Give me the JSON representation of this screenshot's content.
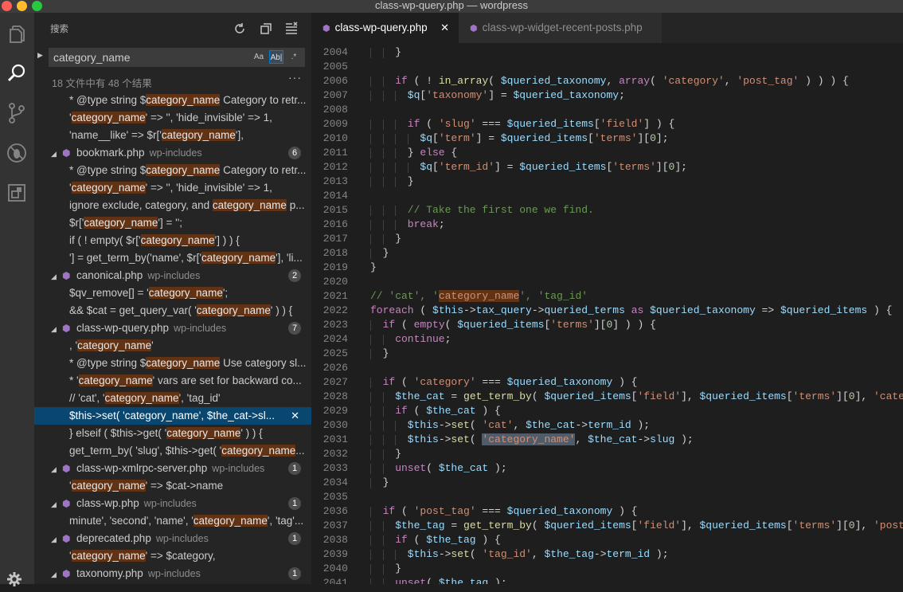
{
  "window": {
    "title": "class-wp-query.php — wordpress"
  },
  "activity_bar": [
    {
      "name": "explorer-icon",
      "active": false
    },
    {
      "name": "search-icon",
      "active": true
    },
    {
      "name": "source-control-icon",
      "active": false
    },
    {
      "name": "debug-icon",
      "active": false
    },
    {
      "name": "extensions-icon",
      "active": false
    }
  ],
  "sidebar": {
    "title": "搜索",
    "search_value": "category_name",
    "opt_case": "Aa",
    "opt_word": "Ab|",
    "opt_regex": ".*",
    "summary": "18 文件中有 48 个结果",
    "more": "···"
  },
  "results": [
    {
      "type": "match",
      "parts": [
        [
          "* @type string $",
          0
        ],
        [
          "category_name",
          1
        ],
        [
          " Category to retr...",
          0
        ]
      ]
    },
    {
      "type": "match",
      "parts": [
        [
          "'",
          0
        ],
        [
          "category_name",
          1
        ],
        [
          "' => '', 'hide_invisible' => 1,",
          0
        ]
      ]
    },
    {
      "type": "match",
      "parts": [
        [
          "'name__like' => $r['",
          0
        ],
        [
          "category_name",
          1
        ],
        [
          "'],",
          0
        ]
      ]
    },
    {
      "type": "file",
      "name": "bookmark.php",
      "dir": "wp-includes",
      "count": "6"
    },
    {
      "type": "match",
      "parts": [
        [
          "* @type string $",
          0
        ],
        [
          "category_name",
          1
        ],
        [
          " Category to retr...",
          0
        ]
      ]
    },
    {
      "type": "match",
      "parts": [
        [
          "'",
          0
        ],
        [
          "category_name",
          1
        ],
        [
          "' => '', 'hide_invisible' => 1,",
          0
        ]
      ]
    },
    {
      "type": "match",
      "parts": [
        [
          "ignore exclude, category, and ",
          0
        ],
        [
          "category_name",
          1
        ],
        [
          " p...",
          0
        ]
      ]
    },
    {
      "type": "match",
      "parts": [
        [
          "$r['",
          0
        ],
        [
          "category_name",
          1
        ],
        [
          "'] = '';",
          0
        ]
      ]
    },
    {
      "type": "match",
      "parts": [
        [
          "if ( ! empty( $r['",
          0
        ],
        [
          "category_name",
          1
        ],
        [
          "'] ) ) {",
          0
        ]
      ]
    },
    {
      "type": "match",
      "parts": [
        [
          "'] = get_term_by('name', $r['",
          0
        ],
        [
          "category_name",
          1
        ],
        [
          "'], 'li...",
          0
        ]
      ]
    },
    {
      "type": "file",
      "name": "canonical.php",
      "dir": "wp-includes",
      "count": "2"
    },
    {
      "type": "match",
      "parts": [
        [
          "$qv_remove[] = '",
          0
        ],
        [
          "category_name",
          1
        ],
        [
          "';",
          0
        ]
      ]
    },
    {
      "type": "match",
      "parts": [
        [
          "&& $cat = get_query_var( '",
          0
        ],
        [
          "category_name",
          1
        ],
        [
          "' ) ) {",
          0
        ]
      ]
    },
    {
      "type": "file",
      "name": "class-wp-query.php",
      "dir": "wp-includes",
      "count": "7"
    },
    {
      "type": "match",
      "parts": [
        [
          ", '",
          0
        ],
        [
          "category_name",
          1
        ],
        [
          "'",
          0
        ]
      ]
    },
    {
      "type": "match",
      "parts": [
        [
          "* @type string $",
          0
        ],
        [
          "category_name",
          1
        ],
        [
          " Use category sl...",
          0
        ]
      ]
    },
    {
      "type": "match",
      "parts": [
        [
          "* '",
          0
        ],
        [
          "category_name",
          1
        ],
        [
          "' vars are set for backward co...",
          0
        ]
      ]
    },
    {
      "type": "match",
      "parts": [
        [
          "// 'cat', '",
          0
        ],
        [
          "category_name",
          1
        ],
        [
          "', 'tag_id'",
          0
        ]
      ]
    },
    {
      "type": "match",
      "selected": true,
      "parts": [
        [
          "$this->set( '",
          0
        ],
        [
          "category_name",
          1
        ],
        [
          "', $the_cat->sl...",
          0
        ]
      ]
    },
    {
      "type": "match",
      "parts": [
        [
          "} elseif ( $this->get( '",
          0
        ],
        [
          "category_name",
          1
        ],
        [
          "' ) ) {",
          0
        ]
      ]
    },
    {
      "type": "match",
      "parts": [
        [
          "get_term_by( 'slug', $this->get( '",
          0
        ],
        [
          "category_name",
          1
        ],
        [
          "...",
          0
        ]
      ]
    },
    {
      "type": "file",
      "name": "class-wp-xmlrpc-server.php",
      "dir": "wp-includes",
      "count": "1"
    },
    {
      "type": "match",
      "parts": [
        [
          "'",
          0
        ],
        [
          "category_name",
          1
        ],
        [
          "' => $cat->name",
          0
        ]
      ]
    },
    {
      "type": "file",
      "name": "class-wp.php",
      "dir": "wp-includes",
      "count": "1"
    },
    {
      "type": "match",
      "parts": [
        [
          "minute', 'second', 'name', '",
          0
        ],
        [
          "category_name",
          1
        ],
        [
          "', 'tag'...",
          0
        ]
      ]
    },
    {
      "type": "file",
      "name": "deprecated.php",
      "dir": "wp-includes",
      "count": "1"
    },
    {
      "type": "match",
      "parts": [
        [
          "'",
          0
        ],
        [
          "category_name",
          1
        ],
        [
          "' => $category,",
          0
        ]
      ]
    },
    {
      "type": "file",
      "name": "taxonomy.php",
      "dir": "wp-includes",
      "count": "1"
    }
  ],
  "tabs": [
    {
      "label": "class-wp-query.php",
      "active": true
    },
    {
      "label": "class-wp-widget-recent-posts.php",
      "active": false
    }
  ],
  "code_lines": [
    {
      "n": "2004",
      "indent": 2,
      "toks": [
        [
          "}",
          "p"
        ]
      ]
    },
    {
      "n": "2005",
      "indent": 0,
      "toks": []
    },
    {
      "n": "2006",
      "indent": 2,
      "toks": [
        [
          "if",
          "k"
        ],
        [
          " ( ! ",
          "p"
        ],
        [
          "in_array",
          "f"
        ],
        [
          "( ",
          "p"
        ],
        [
          "$queried_taxonomy",
          "v"
        ],
        [
          ", ",
          "p"
        ],
        [
          "array",
          "k"
        ],
        [
          "( ",
          "p"
        ],
        [
          "'category'",
          "s"
        ],
        [
          ", ",
          "p"
        ],
        [
          "'post_tag'",
          "s"
        ],
        [
          " ) ) ) {",
          "p"
        ]
      ]
    },
    {
      "n": "2007",
      "indent": 3,
      "toks": [
        [
          "$q",
          "v"
        ],
        [
          "[",
          "p"
        ],
        [
          "'taxonomy'",
          "s"
        ],
        [
          "] = ",
          "p"
        ],
        [
          "$queried_taxonomy",
          "v"
        ],
        [
          ";",
          "p"
        ]
      ]
    },
    {
      "n": "2008",
      "indent": 0,
      "toks": []
    },
    {
      "n": "2009",
      "indent": 3,
      "toks": [
        [
          "if",
          "k"
        ],
        [
          " ( ",
          "p"
        ],
        [
          "'slug'",
          "s"
        ],
        [
          " === ",
          "p"
        ],
        [
          "$queried_items",
          "v"
        ],
        [
          "[",
          "p"
        ],
        [
          "'field'",
          "s"
        ],
        [
          "] ) {",
          "p"
        ]
      ]
    },
    {
      "n": "2010",
      "indent": 4,
      "toks": [
        [
          "$q",
          "v"
        ],
        [
          "[",
          "p"
        ],
        [
          "'term'",
          "s"
        ],
        [
          "] = ",
          "p"
        ],
        [
          "$queried_items",
          "v"
        ],
        [
          "[",
          "p"
        ],
        [
          "'terms'",
          "s"
        ],
        [
          "][",
          "p"
        ],
        [
          "0",
          "n"
        ],
        [
          "];",
          "p"
        ]
      ]
    },
    {
      "n": "2011",
      "indent": 3,
      "toks": [
        [
          "} ",
          "p"
        ],
        [
          "else",
          "k"
        ],
        [
          " {",
          "p"
        ]
      ]
    },
    {
      "n": "2012",
      "indent": 4,
      "toks": [
        [
          "$q",
          "v"
        ],
        [
          "[",
          "p"
        ],
        [
          "'term_id'",
          "s"
        ],
        [
          "] = ",
          "p"
        ],
        [
          "$queried_items",
          "v"
        ],
        [
          "[",
          "p"
        ],
        [
          "'terms'",
          "s"
        ],
        [
          "][",
          "p"
        ],
        [
          "0",
          "n"
        ],
        [
          "];",
          "p"
        ]
      ]
    },
    {
      "n": "2013",
      "indent": 3,
      "toks": [
        [
          "}",
          "p"
        ]
      ]
    },
    {
      "n": "2014",
      "indent": 0,
      "toks": []
    },
    {
      "n": "2015",
      "indent": 3,
      "toks": [
        [
          "// Take the first one we find.",
          "c"
        ]
      ]
    },
    {
      "n": "2016",
      "indent": 3,
      "toks": [
        [
          "break",
          "k"
        ],
        [
          ";",
          "p"
        ]
      ]
    },
    {
      "n": "2017",
      "indent": 2,
      "toks": [
        [
          "}",
          "p"
        ]
      ]
    },
    {
      "n": "2018",
      "indent": 1,
      "toks": [
        [
          "}",
          "p"
        ]
      ]
    },
    {
      "n": "2019",
      "indent": 0,
      "toks": [
        [
          "}",
          "p"
        ]
      ]
    },
    {
      "n": "2020",
      "indent": 0,
      "toks": []
    },
    {
      "n": "2021",
      "indent": 0,
      "toks": [
        [
          "// 'cat', '",
          "c"
        ],
        [
          "category_name",
          "h"
        ],
        [
          "', 'tag_id'",
          "c"
        ]
      ]
    },
    {
      "n": "2022",
      "indent": 0,
      "toks": [
        [
          "foreach",
          "k"
        ],
        [
          " ( ",
          "p"
        ],
        [
          "$this",
          "v"
        ],
        [
          "->",
          "p"
        ],
        [
          "tax_query",
          "v"
        ],
        [
          "->",
          "p"
        ],
        [
          "queried_terms",
          "v"
        ],
        [
          " ",
          "p"
        ],
        [
          "as",
          "k"
        ],
        [
          " ",
          "p"
        ],
        [
          "$queried_taxonomy",
          "v"
        ],
        [
          " => ",
          "p"
        ],
        [
          "$queried_items",
          "v"
        ],
        [
          " ) {",
          "p"
        ]
      ]
    },
    {
      "n": "2023",
      "indent": 1,
      "toks": [
        [
          "if",
          "k"
        ],
        [
          " ( ",
          "p"
        ],
        [
          "empty",
          "k"
        ],
        [
          "( ",
          "p"
        ],
        [
          "$queried_items",
          "v"
        ],
        [
          "[",
          "p"
        ],
        [
          "'terms'",
          "s"
        ],
        [
          "][",
          "p"
        ],
        [
          "0",
          "n"
        ],
        [
          "] ) ) {",
          "p"
        ]
      ]
    },
    {
      "n": "2024",
      "indent": 2,
      "toks": [
        [
          "continue",
          "k"
        ],
        [
          ";",
          "p"
        ]
      ]
    },
    {
      "n": "2025",
      "indent": 1,
      "toks": [
        [
          "}",
          "p"
        ]
      ]
    },
    {
      "n": "2026",
      "indent": 0,
      "toks": []
    },
    {
      "n": "2027",
      "indent": 1,
      "toks": [
        [
          "if",
          "k"
        ],
        [
          " ( ",
          "p"
        ],
        [
          "'category'",
          "s"
        ],
        [
          " === ",
          "p"
        ],
        [
          "$queried_taxonomy",
          "v"
        ],
        [
          " ) {",
          "p"
        ]
      ]
    },
    {
      "n": "2028",
      "indent": 2,
      "toks": [
        [
          "$the_cat",
          "v"
        ],
        [
          " = ",
          "p"
        ],
        [
          "get_term_by",
          "f"
        ],
        [
          "( ",
          "p"
        ],
        [
          "$queried_items",
          "v"
        ],
        [
          "[",
          "p"
        ],
        [
          "'field'",
          "s"
        ],
        [
          "], ",
          "p"
        ],
        [
          "$queried_items",
          "v"
        ],
        [
          "[",
          "p"
        ],
        [
          "'terms'",
          "s"
        ],
        [
          "][",
          "p"
        ],
        [
          "0",
          "n"
        ],
        [
          "], ",
          "p"
        ],
        [
          "'category'",
          "s"
        ]
      ]
    },
    {
      "n": "2029",
      "indent": 2,
      "toks": [
        [
          "if",
          "k"
        ],
        [
          " ( ",
          "p"
        ],
        [
          "$the_cat",
          "v"
        ],
        [
          " ) {",
          "p"
        ]
      ]
    },
    {
      "n": "2030",
      "indent": 3,
      "toks": [
        [
          "$this",
          "v"
        ],
        [
          "->",
          "p"
        ],
        [
          "set",
          "f"
        ],
        [
          "( ",
          "p"
        ],
        [
          "'cat'",
          "s"
        ],
        [
          ", ",
          "p"
        ],
        [
          "$the_cat",
          "v"
        ],
        [
          "->",
          "p"
        ],
        [
          "term_id",
          "v"
        ],
        [
          " );",
          "p"
        ]
      ]
    },
    {
      "n": "2031",
      "indent": 3,
      "toks": [
        [
          "$this",
          "v"
        ],
        [
          "->",
          "p"
        ],
        [
          "set",
          "f"
        ],
        [
          "( ",
          "p"
        ],
        [
          "'category_name'",
          "x"
        ],
        [
          ", ",
          "p"
        ],
        [
          "$the_cat",
          "v"
        ],
        [
          "->",
          "p"
        ],
        [
          "slug",
          "v"
        ],
        [
          " );",
          "p"
        ]
      ]
    },
    {
      "n": "2032",
      "indent": 2,
      "toks": [
        [
          "}",
          "p"
        ]
      ]
    },
    {
      "n": "2033",
      "indent": 2,
      "toks": [
        [
          "unset",
          "k"
        ],
        [
          "( ",
          "p"
        ],
        [
          "$the_cat",
          "v"
        ],
        [
          " );",
          "p"
        ]
      ]
    },
    {
      "n": "2034",
      "indent": 1,
      "toks": [
        [
          "}",
          "p"
        ]
      ]
    },
    {
      "n": "2035",
      "indent": 0,
      "toks": []
    },
    {
      "n": "2036",
      "indent": 1,
      "toks": [
        [
          "if",
          "k"
        ],
        [
          " ( ",
          "p"
        ],
        [
          "'post_tag'",
          "s"
        ],
        [
          " === ",
          "p"
        ],
        [
          "$queried_taxonomy",
          "v"
        ],
        [
          " ) {",
          "p"
        ]
      ]
    },
    {
      "n": "2037",
      "indent": 2,
      "toks": [
        [
          "$the_tag",
          "v"
        ],
        [
          " = ",
          "p"
        ],
        [
          "get_term_by",
          "f"
        ],
        [
          "( ",
          "p"
        ],
        [
          "$queried_items",
          "v"
        ],
        [
          "[",
          "p"
        ],
        [
          "'field'",
          "s"
        ],
        [
          "], ",
          "p"
        ],
        [
          "$queried_items",
          "v"
        ],
        [
          "[",
          "p"
        ],
        [
          "'terms'",
          "s"
        ],
        [
          "][",
          "p"
        ],
        [
          "0",
          "n"
        ],
        [
          "], ",
          "p"
        ],
        [
          "'post_tag'",
          "s"
        ]
      ]
    },
    {
      "n": "2038",
      "indent": 2,
      "toks": [
        [
          "if",
          "k"
        ],
        [
          " ( ",
          "p"
        ],
        [
          "$the_tag",
          "v"
        ],
        [
          " ) {",
          "p"
        ]
      ]
    },
    {
      "n": "2039",
      "indent": 3,
      "toks": [
        [
          "$this",
          "v"
        ],
        [
          "->",
          "p"
        ],
        [
          "set",
          "f"
        ],
        [
          "( ",
          "p"
        ],
        [
          "'tag_id'",
          "s"
        ],
        [
          ", ",
          "p"
        ],
        [
          "$the_tag",
          "v"
        ],
        [
          "->",
          "p"
        ],
        [
          "term_id",
          "v"
        ],
        [
          " );",
          "p"
        ]
      ]
    },
    {
      "n": "2040",
      "indent": 2,
      "toks": [
        [
          "}",
          "p"
        ]
      ]
    },
    {
      "n": "2041",
      "indent": 2,
      "toks": [
        [
          "unset",
          "k"
        ],
        [
          "( ",
          "p"
        ],
        [
          "$the_tag",
          "v"
        ],
        [
          " );",
          "p"
        ]
      ]
    }
  ],
  "colors": {
    "accent": "#007acc",
    "selection": "#094771",
    "match_highlight": "#613214",
    "php_icon": "#a074c4"
  }
}
